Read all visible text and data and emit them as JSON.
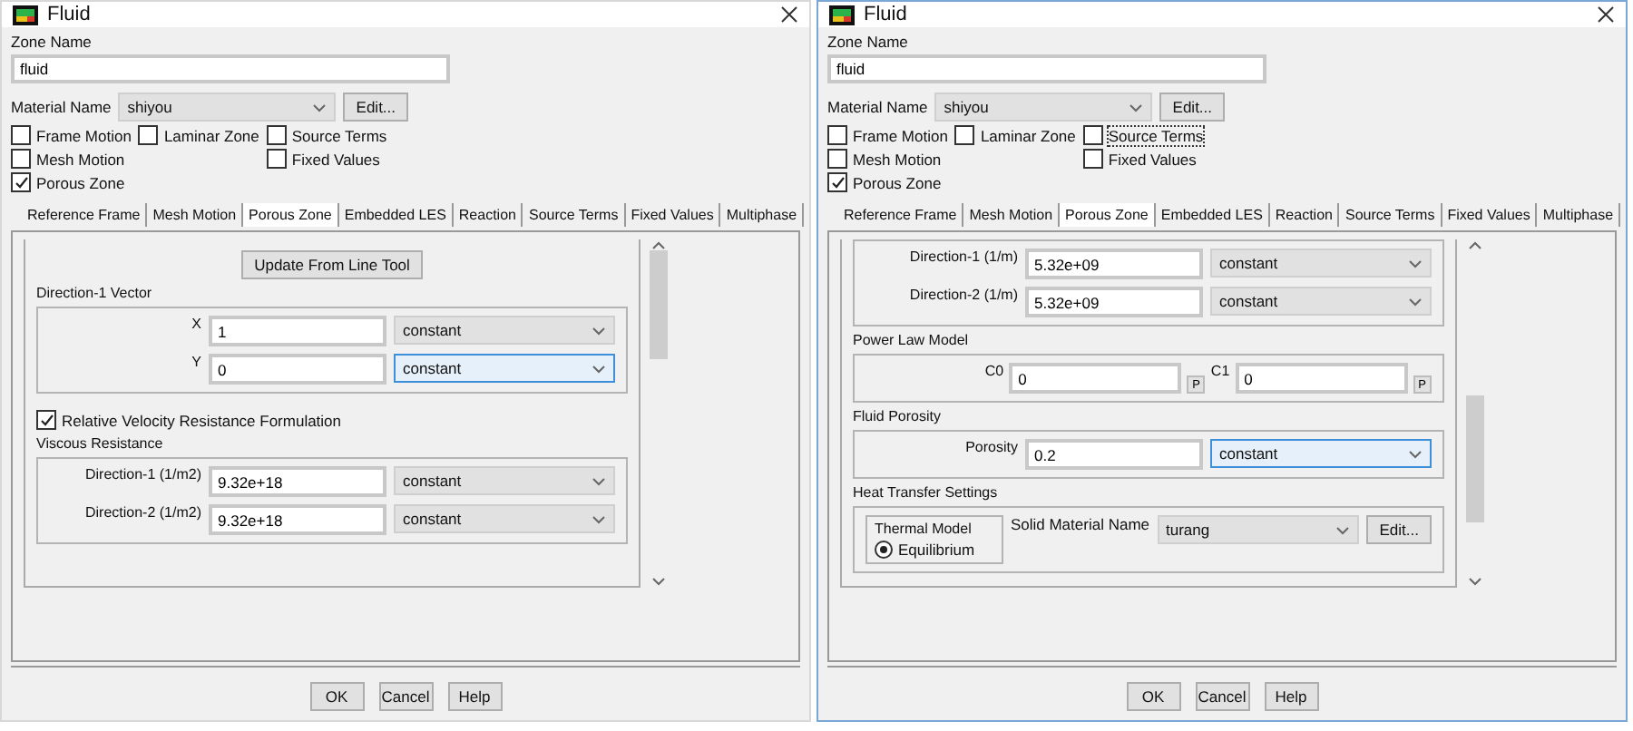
{
  "dialogs": [
    {
      "title": "Fluid",
      "zone_name_label": "Zone Name",
      "zone_name": "fluid",
      "material_label": "Material Name",
      "material": "shiyou",
      "material_edit": "Edit...",
      "option_columns": [
        [
          {
            "label": "Frame Motion",
            "checked": false,
            "focused": false
          },
          {
            "label": "Mesh Motion",
            "checked": false,
            "focused": false
          },
          {
            "label": "Porous Zone",
            "checked": true,
            "focused": false
          }
        ],
        [
          {
            "label": "Laminar Zone",
            "checked": false,
            "focused": false
          }
        ],
        [
          {
            "label": "Source Terms",
            "checked": false,
            "focused": false
          },
          {
            "label": "Fixed Values",
            "checked": false,
            "focused": false
          }
        ]
      ],
      "tabs": [
        {
          "label": "Reference Frame",
          "selected": false
        },
        {
          "label": "Mesh Motion",
          "selected": false
        },
        {
          "label": "Porous Zone",
          "selected": true
        },
        {
          "label": "Embedded LES",
          "selected": false
        },
        {
          "label": "Reaction",
          "selected": false
        },
        {
          "label": "Source Terms",
          "selected": false
        },
        {
          "label": "Fixed Values",
          "selected": false
        },
        {
          "label": "Multiphase",
          "selected": false
        }
      ],
      "panel": {
        "items": [
          {
            "kind": "button",
            "label": "Update From Line Tool"
          },
          {
            "kind": "group",
            "title": "Direction-1 Vector",
            "rows": [
              {
                "kind": "field",
                "label": "X",
                "value": "1",
                "method": "constant",
                "focused": false
              },
              {
                "kind": "field",
                "label": "Y",
                "value": "0",
                "method": "constant",
                "focused": true
              }
            ]
          },
          {
            "kind": "checkbox",
            "label": "Relative Velocity Resistance Formulation",
            "checked": true
          },
          {
            "kind": "group",
            "title": "Viscous Resistance",
            "rows": [
              {
                "kind": "field",
                "label": "Direction-1 (1/m2)",
                "value": "9.32e+18",
                "method": "constant",
                "focused": false
              },
              {
                "kind": "field",
                "label": "Direction-2 (1/m2)",
                "value": "9.32e+18",
                "method": "constant",
                "focused": false
              }
            ]
          }
        ]
      },
      "buttons": [
        "OK",
        "Cancel",
        "Help"
      ]
    },
    {
      "title": "Fluid",
      "zone_name_label": "Zone Name",
      "zone_name": "fluid",
      "material_label": "Material Name",
      "material": "shiyou",
      "material_edit": "Edit...",
      "option_columns": [
        [
          {
            "label": "Frame Motion",
            "checked": false,
            "focused": false
          },
          {
            "label": "Mesh Motion",
            "checked": false,
            "focused": false
          },
          {
            "label": "Porous Zone",
            "checked": true,
            "focused": false
          }
        ],
        [
          {
            "label": "Laminar Zone",
            "checked": false,
            "focused": false
          }
        ],
        [
          {
            "label": "Source Terms",
            "checked": false,
            "focused": true
          },
          {
            "label": "Fixed Values",
            "checked": false,
            "focused": false
          }
        ]
      ],
      "tabs": [
        {
          "label": "Reference Frame",
          "selected": false
        },
        {
          "label": "Mesh Motion",
          "selected": false
        },
        {
          "label": "Porous Zone",
          "selected": true
        },
        {
          "label": "Embedded LES",
          "selected": false
        },
        {
          "label": "Reaction",
          "selected": false
        },
        {
          "label": "Source Terms",
          "selected": false
        },
        {
          "label": "Fixed Values",
          "selected": false
        },
        {
          "label": "Multiphase",
          "selected": false
        }
      ],
      "panel": {
        "items": [
          {
            "kind": "group",
            "rows": [
              {
                "kind": "field",
                "label": "Direction-1 (1/m)",
                "value": "5.32e+09",
                "method": "constant",
                "focused": false
              },
              {
                "kind": "field",
                "label": "Direction-2 (1/m)",
                "value": "5.32e+09",
                "method": "constant",
                "focused": false
              }
            ]
          },
          {
            "kind": "group",
            "title": "Power Law Model",
            "rows": [
              {
                "kind": "pair",
                "fields": [
                  {
                    "label": "C0",
                    "value": "0",
                    "button": "P"
                  },
                  {
                    "label": "C1",
                    "value": "0",
                    "button": "P"
                  }
                ]
              }
            ]
          },
          {
            "kind": "group",
            "title": "Fluid Porosity",
            "rows": [
              {
                "kind": "field",
                "label": "Porosity",
                "value": "0.2",
                "method": "constant",
                "focused": true
              }
            ]
          },
          {
            "kind": "heat",
            "title": "Heat Transfer Settings",
            "model_title": "Thermal Model",
            "models": [
              {
                "label": "Equilibrium",
                "selected": true
              }
            ],
            "solid_label": "Solid Material Name",
            "solid": "turang",
            "edit": "Edit..."
          }
        ]
      },
      "buttons": [
        "OK",
        "Cancel",
        "Help"
      ]
    }
  ]
}
